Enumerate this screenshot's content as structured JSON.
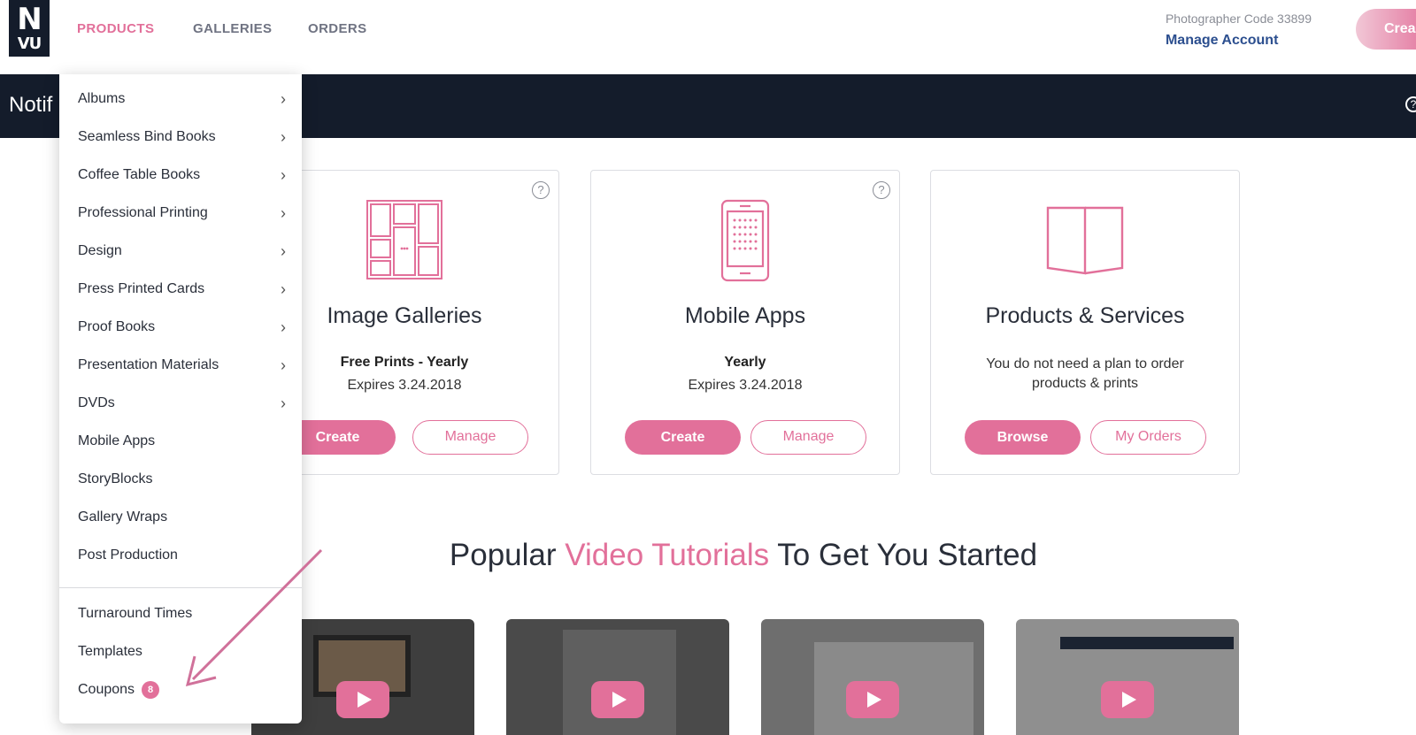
{
  "logo": {
    "line1": "N",
    "line2": "VU"
  },
  "nav": {
    "products": "PRODUCTS",
    "galleries": "GALLERIES",
    "orders": "ORDERS"
  },
  "account": {
    "code_text": "Photographer Code 33899",
    "manage_label": "Manage Account",
    "create_label": "Crea"
  },
  "band": {
    "title": "Notif"
  },
  "cards": [
    {
      "title": "Image Galleries",
      "plan": "Free Prints - Yearly",
      "expires": "Expires 3.24.2018",
      "primary": "Create",
      "secondary": "Manage"
    },
    {
      "title": "Mobile Apps",
      "plan": "Yearly",
      "expires": "Expires 3.24.2018",
      "primary": "Create",
      "secondary": "Manage"
    },
    {
      "title": "Products & Services",
      "desc": "You do not need a plan to order products & prints",
      "primary": "Browse",
      "secondary": "My Orders"
    }
  ],
  "tutorials": {
    "prefix": "Popular ",
    "highlight": "Video Tutorials",
    "suffix": " To Get You Started"
  },
  "dropdown": {
    "items": [
      {
        "label": "Albums",
        "chevron": true
      },
      {
        "label": "Seamless Bind Books",
        "chevron": true
      },
      {
        "label": "Coffee Table Books",
        "chevron": true
      },
      {
        "label": "Professional Printing",
        "chevron": true
      },
      {
        "label": "Design",
        "chevron": true
      },
      {
        "label": "Press Printed Cards",
        "chevron": true
      },
      {
        "label": "Proof Books",
        "chevron": true
      },
      {
        "label": "Presentation Materials",
        "chevron": true
      },
      {
        "label": "DVDs",
        "chevron": true
      },
      {
        "label": "Mobile Apps",
        "chevron": false
      },
      {
        "label": "StoryBlocks",
        "chevron": false
      },
      {
        "label": "Gallery Wraps",
        "chevron": false
      },
      {
        "label": "Post Production",
        "chevron": false
      }
    ],
    "secondary": [
      {
        "label": "Turnaround Times"
      },
      {
        "label": "Templates"
      },
      {
        "label": "Coupons",
        "badge": "8"
      }
    ]
  },
  "colors": {
    "accent": "#e2709a",
    "navy": "#141c2b",
    "link": "#2c4f8f"
  }
}
